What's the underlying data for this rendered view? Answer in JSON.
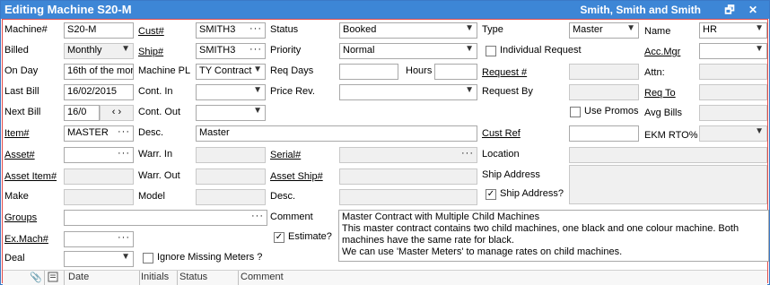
{
  "window": {
    "title": "Editing Machine S20-M",
    "customer_name": "Smith, Smith and Smith",
    "restore_glyph": "🗗",
    "close_glyph": "✕"
  },
  "labels": {
    "machine": "Machine#",
    "billed": "Billed",
    "on_day": "On Day",
    "last_bill": "Last Bill",
    "next_bill": "Next Bill",
    "item": "Item#",
    "asset": "Asset#",
    "asset_item": "Asset Item#",
    "make": "Make",
    "groups": "Groups",
    "ex_mach": "Ex.Mach#",
    "deal": "Deal",
    "cust": "Cust#",
    "ship": "Ship#",
    "machine_pl": "Machine PL",
    "cont_in": "Cont. In",
    "cont_out": "Cont. Out",
    "desc": "Desc.",
    "warr_in": "Warr. In",
    "warr_out": "Warr. Out",
    "model": "Model",
    "status": "Status",
    "priority": "Priority",
    "req_days": "Req Days",
    "hours": "Hours",
    "price_rev": "Price Rev.",
    "serial": "Serial#",
    "asset_ship": "Asset Ship#",
    "desc2": "Desc.",
    "comment": "Comment",
    "estimate": "Estimate?",
    "type": "Type",
    "individual_request": "Individual Request",
    "request_num": "Request #",
    "request_by": "Request By",
    "use_promos": "Use Promos",
    "cust_ref": "Cust Ref",
    "location": "Location",
    "ship_address": "Ship Address",
    "ship_address_q": "Ship Address?",
    "ignore_missing_meters": "Ignore Missing Meters ?",
    "name": "Name",
    "acc_mgr": "Acc.Mgr",
    "attn": "Attn:",
    "req_to": "Req To",
    "avg_bills": "Avg Bills",
    "ekm_rto": "EKM RTO%"
  },
  "values": {
    "machine": "S20-M",
    "billed": "Monthly",
    "on_day": "16th of the mor",
    "last_bill": "16/02/2015",
    "next_bill": "16/0",
    "item": "MASTER",
    "cust": "SMITH3",
    "ship": "SMITH3",
    "machine_pl": "TY Contract",
    "desc": "Master",
    "status": "Booked",
    "priority": "Normal",
    "type": "Master",
    "name": "HR",
    "comment": "Master Contract with Multiple Child Machines\nThis master contract contains two child machines, one black and one colour machine. Both machines have the same rate for black.\nWe can use 'Master Meters' to manage rates on child machines."
  },
  "checkboxes": {
    "individual_request": false,
    "use_promos": false,
    "ship_address_q": true,
    "estimate": true,
    "ignore_missing_meters": false
  },
  "glyphs": {
    "dots": "···",
    "dropdown": "▼",
    "check": "✓",
    "stepper": "‹ ›"
  },
  "grid": {
    "columns": [
      "Date",
      "Initials",
      "Status",
      "Comment"
    ],
    "icons": [
      "paperclip-icon",
      "notes-icon"
    ]
  }
}
